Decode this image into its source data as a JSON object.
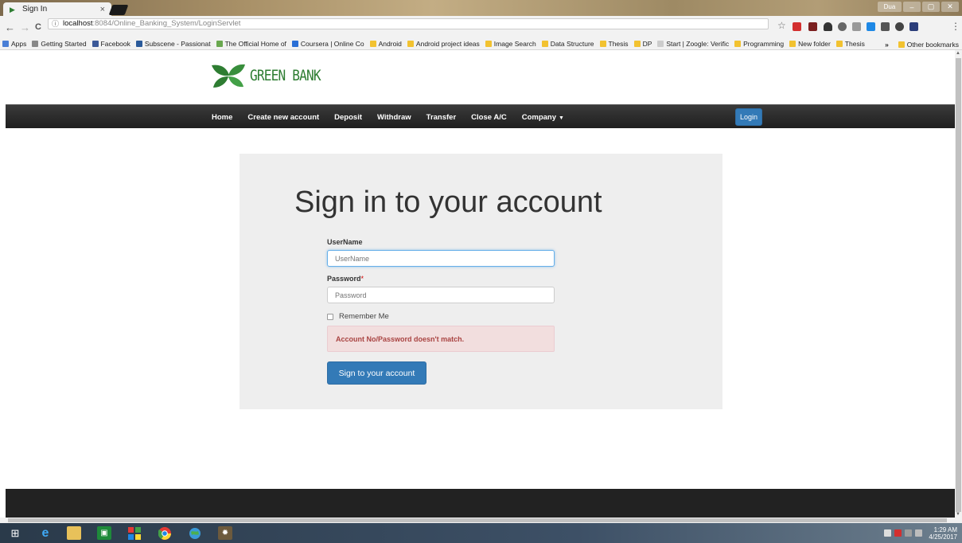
{
  "browser": {
    "tab_title": "Sign In",
    "tab_close": "×",
    "window_user": "Dua",
    "window_controls": [
      "–",
      "▢",
      "✕"
    ],
    "address": {
      "info_icon": "ⓘ",
      "host": "localhost",
      "path": ":8084/Online_Banking_System/LoginServlet"
    },
    "nav": {
      "back": "←",
      "forward": "→",
      "reload": "C"
    },
    "bookmarks": [
      {
        "label": "Apps",
        "color": "#4a7fd6"
      },
      {
        "label": "Getting Started",
        "color": "#888888"
      },
      {
        "label": "Facebook",
        "color": "#3b5998"
      },
      {
        "label": "Subscene - Passionat",
        "color": "#2a5a9a"
      },
      {
        "label": "The Official Home of",
        "color": "#6aa84f"
      },
      {
        "label": "Coursera | Online Co",
        "color": "#2a6fd6"
      },
      {
        "label": "Android",
        "color": "#f2c230"
      },
      {
        "label": "Android project ideas",
        "color": "#f2c230"
      },
      {
        "label": "Image Search",
        "color": "#f2c230"
      },
      {
        "label": "Data Structure",
        "color": "#f2c230"
      },
      {
        "label": "Thesis",
        "color": "#f2c230"
      },
      {
        "label": "DP",
        "color": "#f2c230"
      },
      {
        "label": "Start | Zoogle: Verific",
        "color": "#cccccc"
      },
      {
        "label": "Programming",
        "color": "#f2c230"
      },
      {
        "label": "New folder",
        "color": "#f2c230"
      },
      {
        "label": "Thesis",
        "color": "#f2c230"
      }
    ],
    "bookmarks_overflow": "»",
    "other_bookmarks": "Other bookmarks"
  },
  "site": {
    "logo_text": "GREEN BANK",
    "logo_color": "#2e7d32",
    "nav": {
      "home": "Home",
      "create": "Create new account",
      "deposit": "Deposit",
      "withdraw": "Withdraw",
      "transfer": "Transfer",
      "close": "Close A/C",
      "company": "Company",
      "login": "Login"
    }
  },
  "form": {
    "heading": "Sign in to your account",
    "username_label": "UserName",
    "username_placeholder": "UserName",
    "password_label": "Password",
    "password_required": "*",
    "password_placeholder": "Password",
    "remember_label": "Remember Me",
    "error": "Account No/Password doesn't match.",
    "submit": "Sign to your account"
  },
  "taskbar": {
    "time": "1:29 AM",
    "date": "4/25/2017"
  },
  "colors": {
    "primary": "#337ab7",
    "navbar": "#222222",
    "panel": "#eeeeee",
    "error_bg": "#f2dede",
    "error_text": "#a94442"
  }
}
